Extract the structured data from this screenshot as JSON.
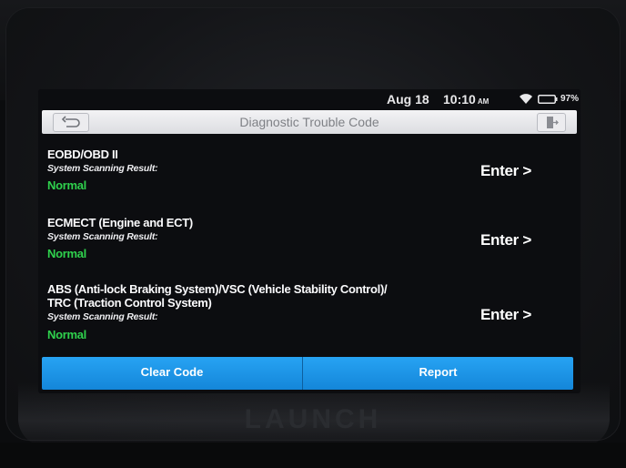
{
  "status_bar": {
    "date": "Aug 18",
    "time": "10:10",
    "ampm": "AM",
    "battery": "97%"
  },
  "header": {
    "title": "Diagnostic Trouble Code"
  },
  "systems": [
    {
      "name": "EOBD/OBD II",
      "result_label": "System Scanning Result:",
      "result": "Normal",
      "action": "Enter >"
    },
    {
      "name": "ECMECT (Engine and ECT)",
      "result_label": "System Scanning Result:",
      "result": "Normal",
      "action": "Enter >"
    },
    {
      "name_line1": "ABS (Anti-lock Braking System)/VSC (Vehicle Stability Control)/",
      "name_line2": "TRC (Traction Control System)",
      "result_label": "System Scanning Result:",
      "result": "Normal",
      "action": "Enter >"
    }
  ],
  "footer": {
    "clear_label": "Clear Code",
    "report_label": "Report"
  },
  "device": {
    "brand": "LAUNCH"
  },
  "colors": {
    "accent_blue": "#1a93e6",
    "status_green": "#2fd14d",
    "titlebar_bg": "#e8e9ec"
  }
}
